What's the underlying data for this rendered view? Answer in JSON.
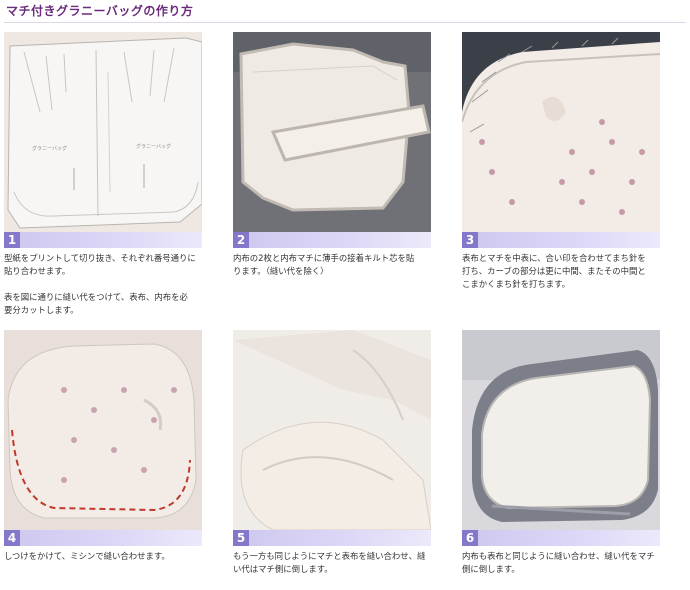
{
  "page": {
    "title": "マチ付きグラニーバッグの作り方"
  },
  "steps": [
    {
      "number": "1",
      "caption": "型紙をプリントして切り抜き、それぞれ番号通りに\n貼り合わせます。\n\n表を図に通りに縫い代をつけて、表布、内布を必\n要分カットします。"
    },
    {
      "number": "2",
      "caption": "内布の2枚と内布マチに薄手の接着キルト芯を貼\nります。（縫い代を除く）"
    },
    {
      "number": "3",
      "caption": "表布とマチを中表に、合い印を合わせてまち針を\n打ち、カーブの部分は更に中間、またその中間と\nこまかくまち針を打ちます。"
    },
    {
      "number": "4",
      "caption": "しつけをかけて、ミシンで縫い合わせます。"
    },
    {
      "number": "5",
      "caption": "もう一方も同じようにマチと表布を縫い合わせ、縫\nい代はマチ側に倒します。"
    },
    {
      "number": "6",
      "caption": "内布も表布と同じように縫い合わせ、縫い代をマチ\n側に倒します。"
    }
  ]
}
